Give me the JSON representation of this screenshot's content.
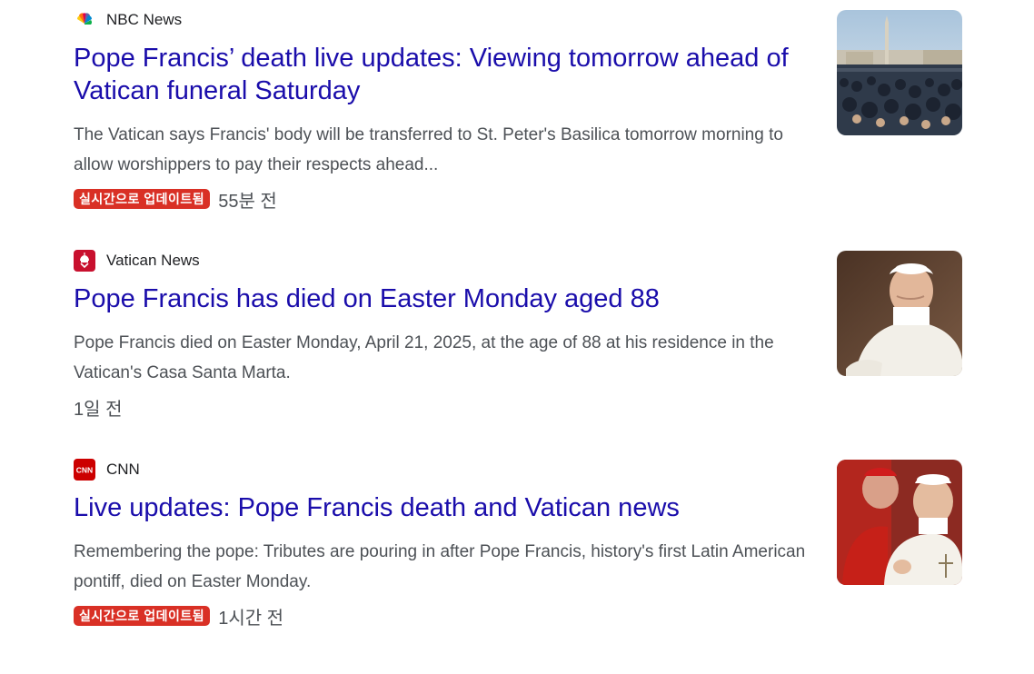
{
  "articles": [
    {
      "source": "NBC News",
      "source_icon": "nbc-peacock-icon",
      "headline": "Pope Francis’ death live updates: Viewing tomorrow ahead of Vatican funeral Saturday",
      "snippet": "The Vatican says Francis' body will be transferred to St. Peter's Basilica tomorrow morning to allow worshippers to pay their respects ahead...",
      "badge": "실시간으로 업데이트됨",
      "time": "55분 전",
      "thumbnail": "crowd-at-st-peters-square"
    },
    {
      "source": "Vatican News",
      "source_icon": "vatican-emblem-icon",
      "headline": "Pope Francis has died on Easter Monday aged 88",
      "snippet": "Pope Francis died on Easter Monday, April 21, 2025, at the age of 88 at his residence in the Vatican's Casa Santa Marta.",
      "badge": "",
      "time": "1일 전",
      "thumbnail": "pope-francis-portrait"
    },
    {
      "source": "CNN",
      "source_icon": "cnn-logo-icon",
      "headline": "Live updates: Pope Francis death and Vatican news",
      "snippet": "Remembering the pope: Tributes are pouring in after Pope Francis, history's first Latin American pontiff, died on Easter Monday.",
      "badge": "실시간으로 업데이트됨",
      "time": "1시간 전",
      "thumbnail": "pope-francis-with-cardinal"
    }
  ],
  "colors": {
    "headline": "#1a0dab",
    "snippet": "#4d5156",
    "badge_bg": "#d93025",
    "cnn_red": "#cc0000",
    "vatican_red": "#c8102e"
  }
}
